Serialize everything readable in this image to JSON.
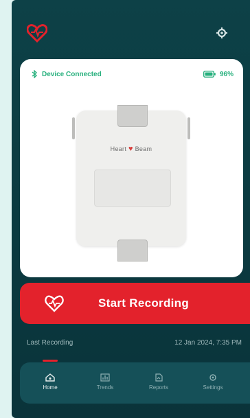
{
  "colors": {
    "accent": "#e3222c",
    "connected": "#27b07d",
    "background": "#0d4147"
  },
  "header": {
    "logo_icon": "heart-logo-icon",
    "settings_icon": "gear-icon"
  },
  "device_card": {
    "connection_status": "Device Connected",
    "battery_level": "96%",
    "brand_left": "Heart",
    "brand_right": "Beam"
  },
  "record_button": {
    "label": "Start Recording",
    "icon": "heart-pulse-icon"
  },
  "last_recording": {
    "label": "Last Recording",
    "value": "12 Jan 2024, 7:35 PM"
  },
  "nav": {
    "items": [
      {
        "label": "Home",
        "icon": "home-icon",
        "active": true
      },
      {
        "label": "Trends",
        "icon": "chart-icon",
        "active": false
      },
      {
        "label": "Reports",
        "icon": "report-icon",
        "active": false
      },
      {
        "label": "Settings",
        "icon": "gear-icon",
        "active": false
      }
    ]
  }
}
